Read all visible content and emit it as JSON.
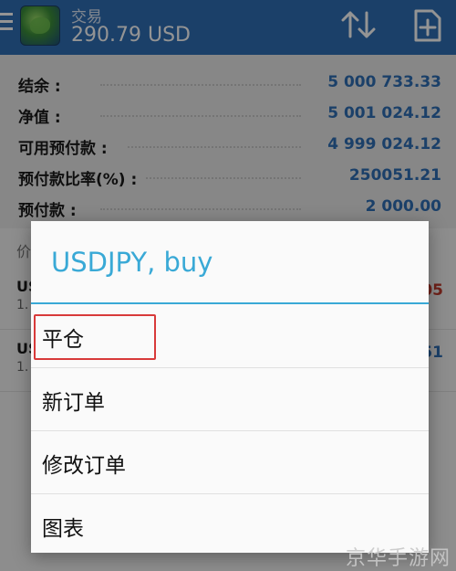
{
  "appbar": {
    "title": "交易",
    "subtitle": "290.79 USD"
  },
  "summary": {
    "rows": [
      {
        "label": "结余 :",
        "value": "5 000 733.33"
      },
      {
        "label": "净值 :",
        "value": "5 001 024.12"
      },
      {
        "label": "可用预付款 :",
        "value": "4 999 024.12"
      },
      {
        "label": "预付款比率(%) :",
        "value": "250051.21"
      },
      {
        "label": "预付款 :",
        "value": "2 000.00"
      }
    ]
  },
  "positions": {
    "header": "价",
    "rows": [
      {
        "symbol": "US",
        "sub": "1.",
        "pnl": "05",
        "pnl_color": "#c0392b"
      },
      {
        "symbol": "US",
        "sub": "1.",
        "pnl": "51",
        "pnl_color": "#2f6fb6"
      }
    ]
  },
  "dialog": {
    "title": "USDJPY, buy",
    "items": [
      {
        "label": "平仓"
      },
      {
        "label": "新订单"
      },
      {
        "label": "修改订单"
      },
      {
        "label": "图表"
      }
    ]
  },
  "watermark": "京华手游网",
  "colors": {
    "appbar": "#2f6fb6",
    "accent": "#39a9d6",
    "value_blue": "#2f6fb6",
    "highlight_red": "#d83a3a"
  }
}
